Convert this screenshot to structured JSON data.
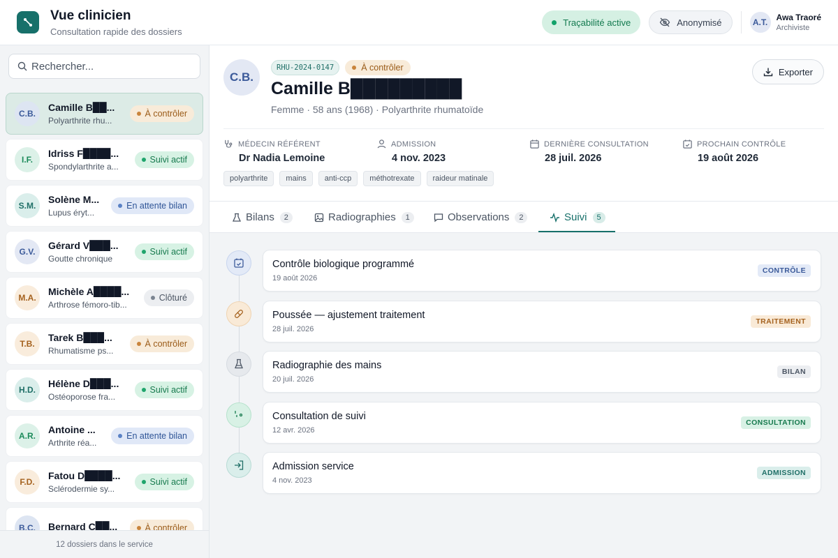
{
  "header": {
    "title": "Vue clinicien",
    "subtitle": "Consultation rapide des dossiers",
    "traceability": "Traçabilité active",
    "anonymize": "Anonymisé",
    "user": {
      "initials": "A.T.",
      "name": "Awa Traoré",
      "role": "Archiviste"
    }
  },
  "sidebar": {
    "search_placeholder": "Rechercher...",
    "footer": "12 dossiers dans le service",
    "patients": [
      {
        "initials": "C.B.",
        "name": "Camille B██...",
        "diagnosis": "Polyarthrite rhu...",
        "status": "À contrôler",
        "status_color": "orange",
        "avatar_bg": "#dde5f2",
        "avatar_fg": "#3b5a9a",
        "active": true
      },
      {
        "initials": "I.F.",
        "name": "Idriss F████...",
        "diagnosis": "Spondylarthrite a...",
        "status": "Suivi actif",
        "status_color": "green",
        "avatar_bg": "#dcf1e8",
        "avatar_fg": "#1b8a5a",
        "active": false
      },
      {
        "initials": "S.M.",
        "name": "Solène M...",
        "diagnosis": "Lupus éryt...",
        "status": "En attente bilan",
        "status_color": "blue",
        "avatar_bg": "#daeeeb",
        "avatar_fg": "#1f6f67",
        "active": false
      },
      {
        "initials": "G.V.",
        "name": "Gérard V███...",
        "diagnosis": "Goutte chronique",
        "status": "Suivi actif",
        "status_color": "green",
        "avatar_bg": "#e3e8f4",
        "avatar_fg": "#3b5a9a",
        "active": false
      },
      {
        "initials": "M.A.",
        "name": "Michèle A████...",
        "diagnosis": "Arthrose fémoro-tib...",
        "status": "Clôturé",
        "status_color": "gray",
        "avatar_bg": "#f9ecdc",
        "avatar_fg": "#a5621f",
        "active": false
      },
      {
        "initials": "T.B.",
        "name": "Tarek B███...",
        "diagnosis": "Rhumatisme ps...",
        "status": "À contrôler",
        "status_color": "orange",
        "avatar_bg": "#f9ecdc",
        "avatar_fg": "#a5621f",
        "active": false
      },
      {
        "initials": "H.D.",
        "name": "Hélène D███...",
        "diagnosis": "Ostéoporose fra...",
        "status": "Suivi actif",
        "status_color": "green",
        "avatar_bg": "#daeeeb",
        "avatar_fg": "#1f6f67",
        "active": false
      },
      {
        "initials": "A.R.",
        "name": "Antoine ...",
        "diagnosis": "Arthrite réa...",
        "status": "En attente bilan",
        "status_color": "blue",
        "avatar_bg": "#dcf1e8",
        "avatar_fg": "#1b8a5a",
        "active": false
      },
      {
        "initials": "F.D.",
        "name": "Fatou D████...",
        "diagnosis": "Sclérodermie sy...",
        "status": "Suivi actif",
        "status_color": "green",
        "avatar_bg": "#f9ecdc",
        "avatar_fg": "#a5621f",
        "active": false
      },
      {
        "initials": "B.C.",
        "name": "Bernard C██...",
        "diagnosis": "",
        "status": "À contrôler",
        "status_color": "orange",
        "avatar_bg": "#dde5f2",
        "avatar_fg": "#3b5a9a",
        "active": false
      }
    ]
  },
  "patient": {
    "initials": "C.B.",
    "code": "RHU-2024-0147",
    "status": "À contrôler",
    "name": "Camille B█████████",
    "summary": "Femme · 58 ans (1968) · Polyarthrite rhumatoïde",
    "export_label": "Exporter",
    "fields": {
      "doctor": {
        "label": "MÉDECIN RÉFÉRENT",
        "value": "Dr Nadia Lemoine"
      },
      "admission": {
        "label": "ADMISSION",
        "value": "4 nov. 2023"
      },
      "last_consult": {
        "label": "DERNIÈRE CONSULTATION",
        "value": "28 juil. 2026"
      },
      "next_check": {
        "label": "PROCHAIN CONTRÔLE",
        "value": "19 août 2026"
      }
    },
    "tags": [
      "polyarthrite",
      "mains",
      "anti-ccp",
      "méthotrexate",
      "raideur matinale"
    ]
  },
  "tabs": [
    {
      "label": "Bilans",
      "count": "2"
    },
    {
      "label": "Radiographies",
      "count": "1"
    },
    {
      "label": "Observations",
      "count": "2"
    },
    {
      "label": "Suivi",
      "count": "5"
    }
  ],
  "timeline": [
    {
      "title": "Contrôle biologique programmé",
      "date": "19 août 2026",
      "type": "CONTRÔLE",
      "color": "blue",
      "icon": "calendar-check-icon"
    },
    {
      "title": "Poussée — ajustement traitement",
      "date": "28 juil. 2026",
      "type": "TRAITEMENT",
      "color": "orange",
      "icon": "pill-icon"
    },
    {
      "title": "Radiographie des mains",
      "date": "20 juil. 2026",
      "type": "BILAN",
      "color": "gray",
      "icon": "flask-icon"
    },
    {
      "title": "Consultation de suivi",
      "date": "12 avr. 2026",
      "type": "CONSULTATION",
      "color": "green",
      "icon": "stethoscope-icon"
    },
    {
      "title": "Admission service",
      "date": "4 nov. 2023",
      "type": "ADMISSION",
      "color": "teal",
      "icon": "login-icon"
    }
  ]
}
